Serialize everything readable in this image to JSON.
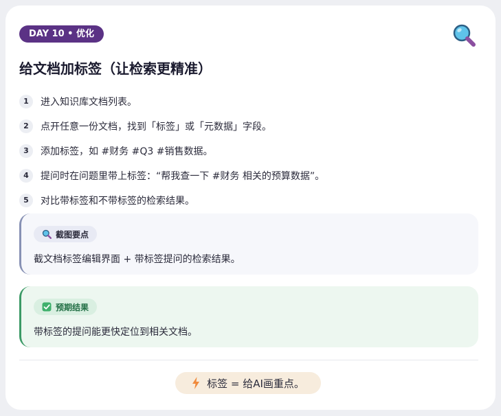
{
  "header": {
    "badge": "DAY 10 • 优化",
    "title": "给文档加标签（让检索更精准）",
    "icon": "magnifier-icon"
  },
  "steps": [
    {
      "num": "1",
      "text": "进入知识库文档列表。"
    },
    {
      "num": "2",
      "text": "点开任意一份文档，找到「标签」或「元数据」字段。"
    },
    {
      "num": "3",
      "text": "添加标签，如 #财务 #Q3 #销售数据。"
    },
    {
      "num": "4",
      "text": "提问时在问题里带上标签：“帮我查一下 #财务 相关的预算数据”。"
    },
    {
      "num": "5",
      "text": "对比带标签和不带标签的检索结果。"
    }
  ],
  "tip_box": {
    "icon": "magnifier-icon",
    "label": "截图要点",
    "text": "截文档标签编辑界面 + 带标签提问的检索结果。",
    "accent": "#8791b4"
  },
  "result_box": {
    "icon": "check-mark-icon",
    "label": "预期结果",
    "text": "带标签的提问能更快定位到相关文档。",
    "accent": "#3c9a66"
  },
  "footer": {
    "icon": "lightning-icon",
    "text": "标签 = 给AI画重点。"
  },
  "colors": {
    "badge_bg": "#5b3285",
    "footer_bg": "#f7ecdd",
    "bolt": "#f08a3c"
  }
}
